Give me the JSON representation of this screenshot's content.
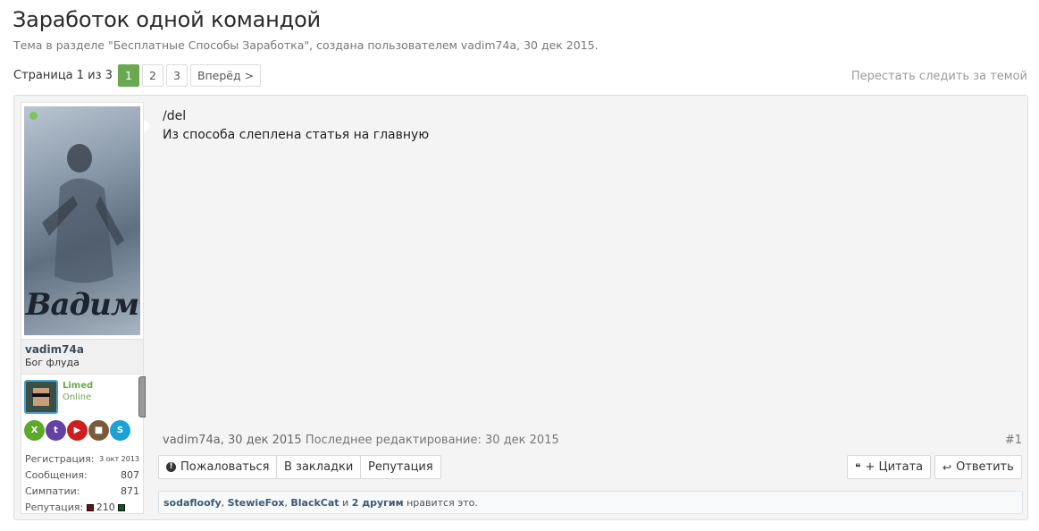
{
  "thread": {
    "title": "Заработок одной командой",
    "subtitle": "Тема в разделе \"Бесплатные Способы Заработка\", создана пользователем vadim74a, 30 дек 2015."
  },
  "pager": {
    "label": "Страница 1 из 3",
    "pages": [
      "1",
      "2",
      "3"
    ],
    "current": "1",
    "next": "Вперёд >"
  },
  "unwatch": "Перестать следить за темой",
  "user": {
    "avatar_text": "Вадим",
    "name": "vadim74a",
    "title": "Бог флуда",
    "group": "Limed",
    "status": "Online",
    "stats": {
      "reg_label": "Регистрация:",
      "reg_value": "3 окт 2013",
      "msgs_label": "Сообщения:",
      "msgs_value": "807",
      "likes_label": "Симпатии:",
      "likes_value": "871",
      "rep_label": "Репутация:",
      "rep_value": "210"
    }
  },
  "post": {
    "line1": "/del",
    "line2": "Из способа слеплена статья на главную",
    "author_date": "vadim74a, 30 дек 2015",
    "edited": "Последнее редактирование: 30 дек 2015",
    "number": "#1"
  },
  "actions": {
    "report": "Пожаловаться",
    "bookmark": "В закладки",
    "reputation": "Репутация",
    "quote": "+ Цитата",
    "reply": "Ответить"
  },
  "likes": {
    "user1": "sodafloofy",
    "user2": "StewieFox",
    "user3": "BlackCat",
    "conj": "и",
    "others": "2 другим",
    "suffix": "нравится это."
  },
  "colors": {
    "accent_green": "#6aa84f",
    "link_blue": "#3c5a78"
  }
}
